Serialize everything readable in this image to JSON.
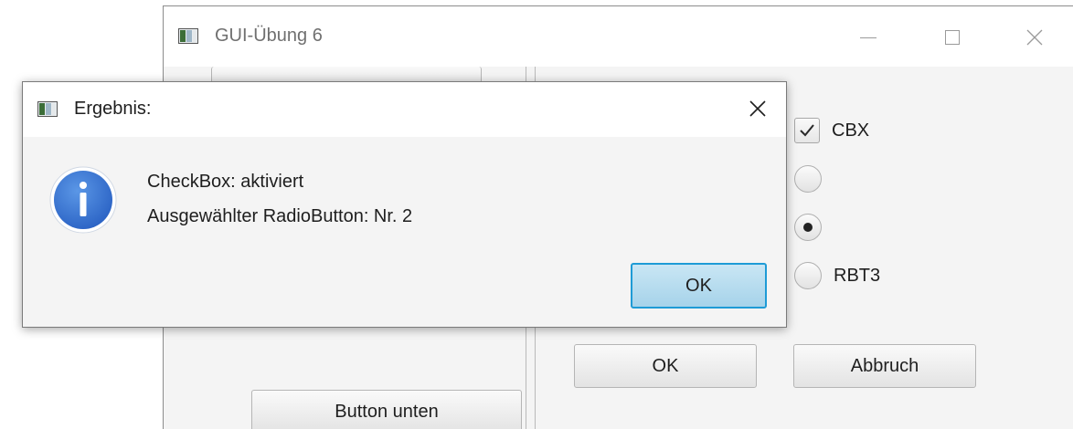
{
  "main_window": {
    "title": "GUI-Übung 6",
    "left_pane": {
      "top_button_label": "",
      "bottom_button_label": "Button unten"
    },
    "right_pane": {
      "checkbox": {
        "label": "CBX",
        "checked": true
      },
      "radio_buttons": [
        {
          "label": "",
          "selected": false
        },
        {
          "label": "",
          "selected": true
        },
        {
          "label": "RBT3",
          "selected": false
        }
      ],
      "ok_label": "OK",
      "cancel_label": "Abbruch"
    }
  },
  "dialog": {
    "title": "Ergebnis:",
    "icon": "info-icon",
    "message_lines": [
      "CheckBox: aktiviert",
      "Ausgewählter RadioButton: Nr. 2"
    ],
    "ok_label": "OK"
  },
  "colors": {
    "info_icon_blue": "#2f6fd0",
    "ok_default_border": "#1e9bd6",
    "ok_default_fill": "#b7dcef"
  }
}
